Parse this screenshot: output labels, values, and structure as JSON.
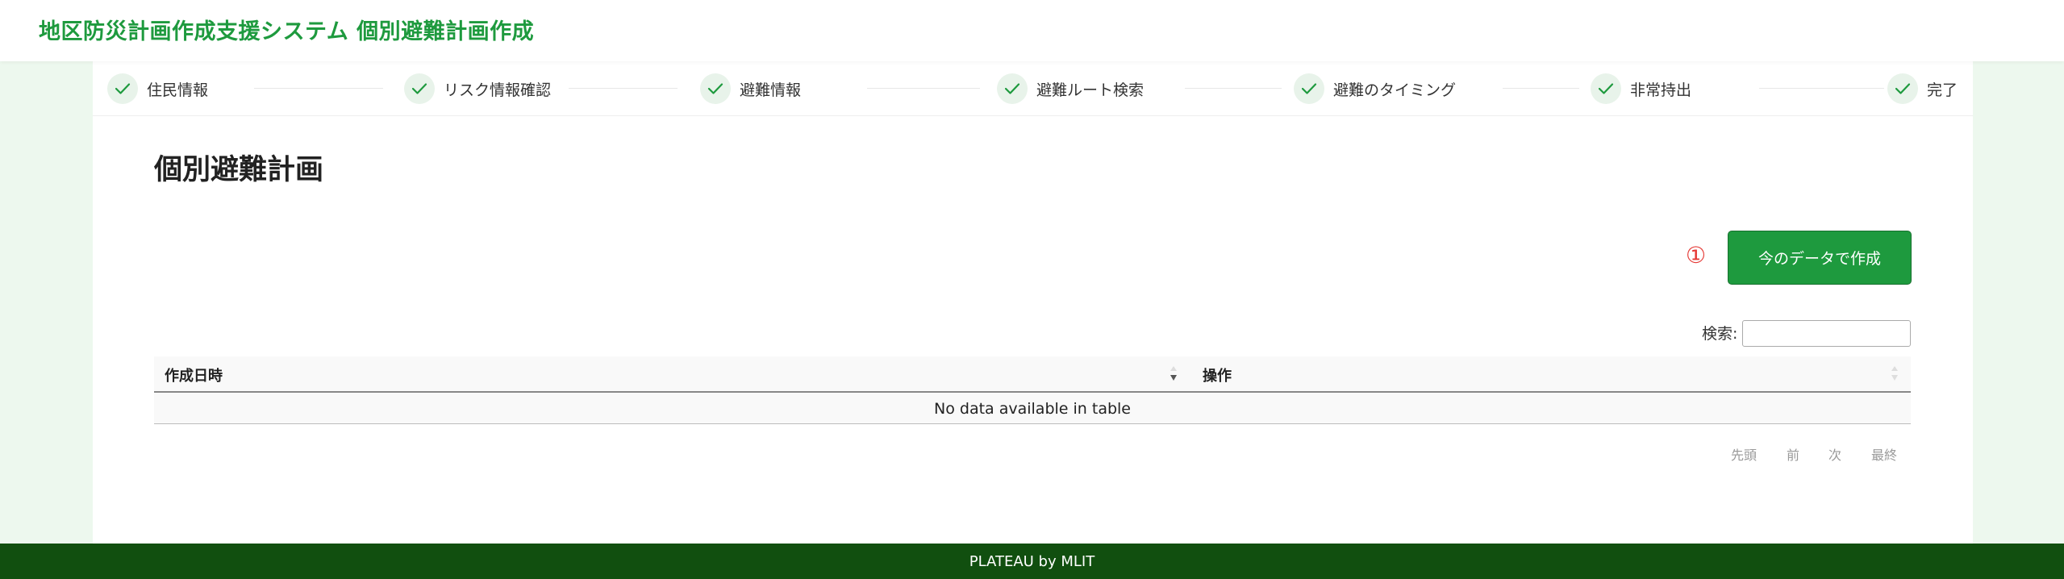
{
  "header": {
    "title": "地区防災計画作成支援システム 個別避難計画作成"
  },
  "stepper": {
    "steps": [
      {
        "label": "住民情報",
        "status": "complete",
        "icon": "check-icon"
      },
      {
        "label": "リスク情報確認",
        "status": "complete",
        "icon": "check-icon"
      },
      {
        "label": "避難情報",
        "status": "complete",
        "icon": "check-icon"
      },
      {
        "label": "避難ルート検索",
        "status": "complete",
        "icon": "check-icon"
      },
      {
        "label": "避難のタイミング",
        "status": "complete",
        "icon": "check-icon"
      },
      {
        "label": "非常持出",
        "status": "complete",
        "icon": "check-icon"
      },
      {
        "label": "完了",
        "status": "complete",
        "icon": "check-icon"
      }
    ]
  },
  "main": {
    "title": "個別避難計画",
    "marker": "①",
    "create_button": "今のデータで作成",
    "search_label": "検索:",
    "search_value": ""
  },
  "table": {
    "columns": [
      {
        "label": "作成日時",
        "sort": "descending"
      },
      {
        "label": "操作",
        "sort": "none"
      }
    ],
    "rows": [],
    "empty_message": "No data available in table"
  },
  "pagination": {
    "first": "先頭",
    "prev": "前",
    "next": "次",
    "last": "最終"
  },
  "footer": {
    "text": "PLATEAU by MLIT"
  },
  "colors": {
    "brand_green": "#1e9a3e",
    "footer_green": "#114f0f",
    "page_background": "#edf8ee",
    "marker_red": "#e53935"
  }
}
